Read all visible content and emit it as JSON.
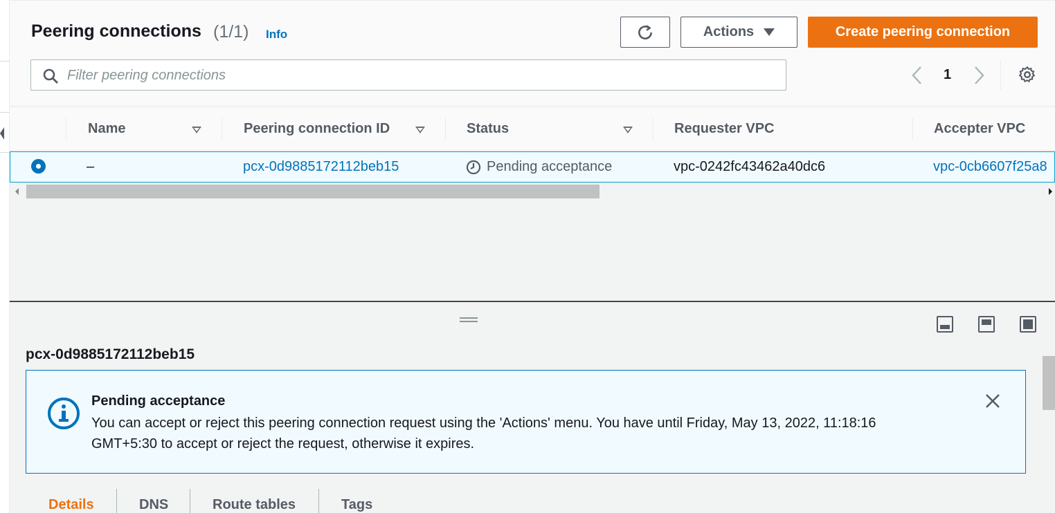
{
  "header": {
    "title": "Peering connections",
    "count": "(1/1)",
    "info_label": "Info",
    "actions_label": "Actions",
    "create_label": "Create peering connection"
  },
  "filter": {
    "placeholder": "Filter peering connections"
  },
  "pagination": {
    "current_page": "1"
  },
  "table": {
    "columns": [
      "Name",
      "Peering connection ID",
      "Status",
      "Requester VPC",
      "Accepter VPC"
    ],
    "rows": [
      {
        "selected": true,
        "name": "–",
        "peering_connection_id": "pcx-0d9885172112beb15",
        "status": "Pending acceptance",
        "requester_vpc": "vpc-0242fc43462a40dc6",
        "accepter_vpc": "vpc-0cb6607f25a8"
      }
    ]
  },
  "detail": {
    "title": "pcx-0d9885172112beb15",
    "alert": {
      "title": "Pending acceptance",
      "body": "You can accept or reject this peering connection request using the 'Actions' menu. You have until Friday, May 13, 2022, 11:18:16 GMT+5:30 to accept or reject the request, otherwise it expires."
    },
    "tabs": [
      {
        "label": "Details",
        "active": true
      },
      {
        "label": "DNS",
        "active": false
      },
      {
        "label": "Route tables",
        "active": false
      },
      {
        "label": "Tags",
        "active": false
      }
    ]
  },
  "icons": [
    "refresh-icon",
    "caret-down-icon",
    "search-icon",
    "chevron-left-icon",
    "chevron-right-icon",
    "gear-icon",
    "sort-icon",
    "clock-icon",
    "info-icon",
    "close-icon",
    "panel-layout-icon"
  ],
  "colors": {
    "primary": "#ec7211",
    "link": "#0073bb",
    "selected_row_bg": "#f1faff",
    "alert_border": "#0073bb"
  }
}
